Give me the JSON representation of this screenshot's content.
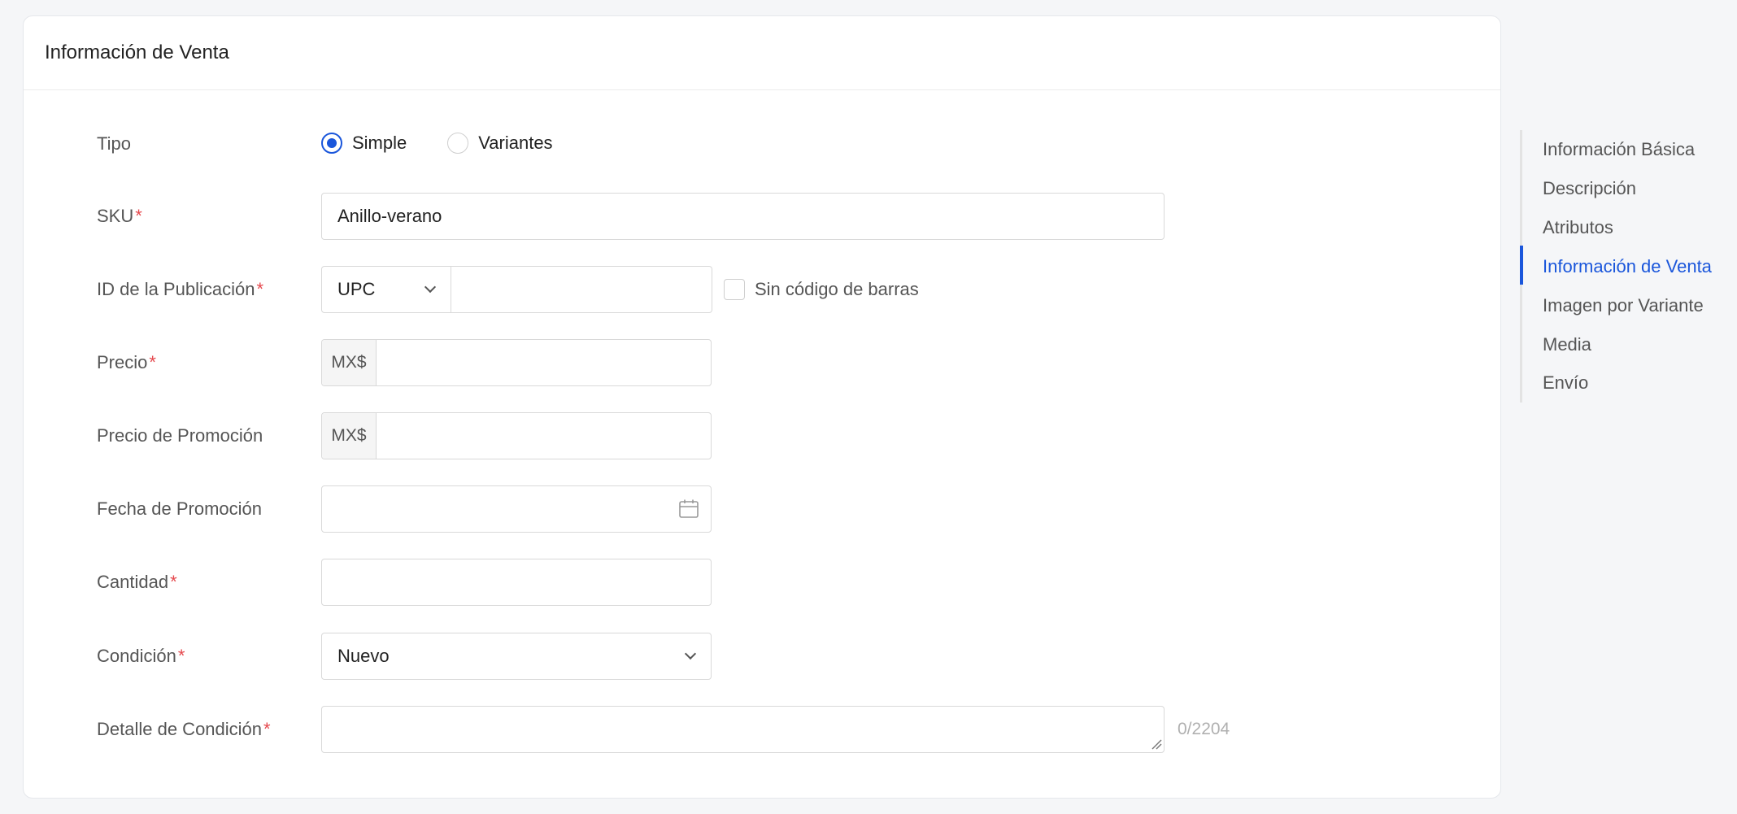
{
  "section": {
    "title": "Información de Venta"
  },
  "form": {
    "tipo": {
      "label": "Tipo",
      "options": [
        {
          "label": "Simple",
          "selected": true
        },
        {
          "label": "Variantes",
          "selected": false
        }
      ]
    },
    "sku": {
      "label": "SKU",
      "required_mark": "*",
      "value": "Anillo-verano"
    },
    "publicacion": {
      "label": "ID de la Publicación",
      "required_mark": "*",
      "code_type": "UPC",
      "code_value": "",
      "no_barcode_label": "Sin código de barras",
      "no_barcode_checked": false
    },
    "precio": {
      "label": "Precio",
      "required_mark": "*",
      "currency": "MX$",
      "value": ""
    },
    "precio_promocion": {
      "label": "Precio de Promoción",
      "currency": "MX$",
      "value": ""
    },
    "fecha_promocion": {
      "label": "Fecha de Promoción",
      "value": "",
      "icon": "calendar-icon"
    },
    "cantidad": {
      "label": "Cantidad",
      "required_mark": "*",
      "value": ""
    },
    "condicion": {
      "label": "Condición",
      "required_mark": "*",
      "value": "Nuevo"
    },
    "detalle_condicion": {
      "label": "Detalle de Condición",
      "required_mark": "*",
      "value": "",
      "counter": "0/2204"
    }
  },
  "anchor_nav": {
    "items": [
      {
        "label": "Información Básica"
      },
      {
        "label": "Descripción"
      },
      {
        "label": "Atributos"
      },
      {
        "label": "Información de Venta"
      },
      {
        "label": "Imagen por Variante"
      },
      {
        "label": "Media"
      },
      {
        "label": "Envío"
      }
    ],
    "active_index": 3
  },
  "colors": {
    "accent": "#1a56db",
    "required": "#e5484d",
    "background": "#f5f6f8"
  }
}
